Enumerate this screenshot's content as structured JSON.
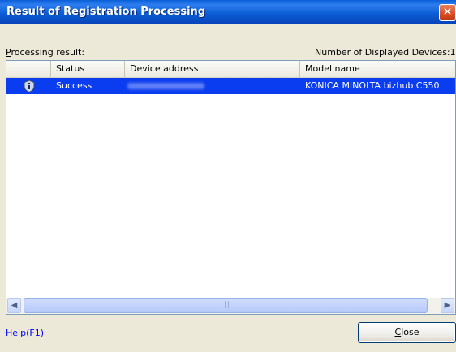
{
  "window": {
    "title": "Result of Registration Processing",
    "close_glyph": "✕"
  },
  "labels": {
    "processing_result_mnemonic": "P",
    "processing_result_rest": "rocessing result:",
    "displayed_devices": "Number of Displayed Devices:1"
  },
  "table": {
    "columns": [
      "Status",
      "Device address",
      "Model name"
    ],
    "rows": [
      {
        "icon": "info-icon",
        "status": "Success",
        "device_address": "",
        "model_name": "KONICA MINOLTA bizhub C550"
      }
    ]
  },
  "scrollbar": {
    "left_arrow": "◀",
    "right_arrow": "▶",
    "grip": "|||"
  },
  "footer": {
    "help_label": "Help(F1)",
    "close_mnemonic": "C",
    "close_rest": "lose"
  },
  "colors": {
    "title_bar": "#0a5fd8",
    "selection": "#0a3cf0",
    "close_button": "#d84d23"
  }
}
